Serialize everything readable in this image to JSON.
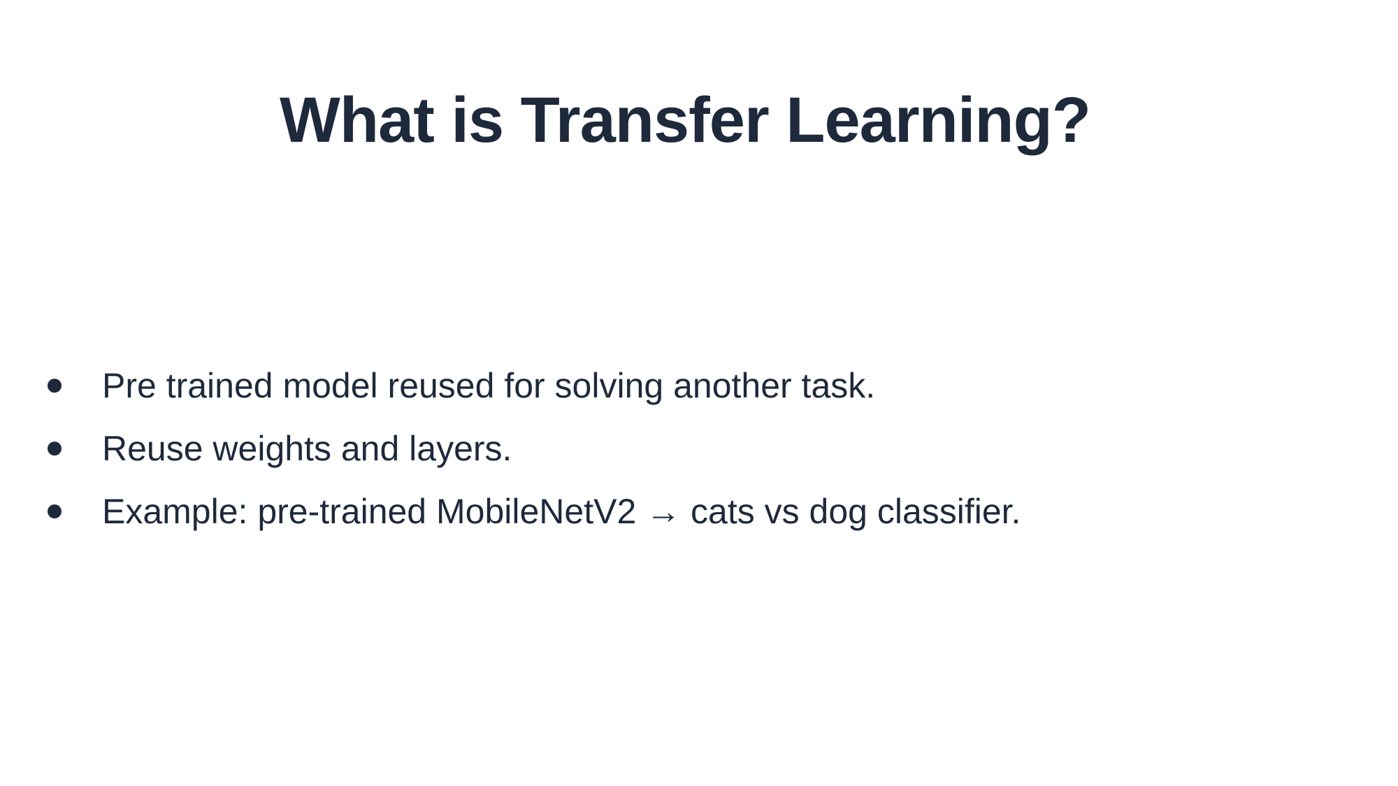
{
  "slide": {
    "title": "What is Transfer Learning?",
    "bullets": [
      "Pre trained model reused for solving another task.",
      "Reuse weights and layers.",
      "Example: pre-trained MobileNetV2 → cats vs dog classifier."
    ]
  }
}
